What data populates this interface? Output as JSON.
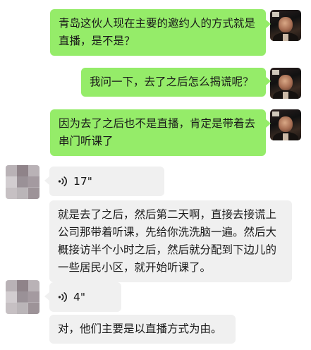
{
  "messages": [
    {
      "id": 1,
      "sender": "me",
      "type": "text",
      "text": "青岛这伙人现在主要的邀约人的方式就是直播，是不是？"
    },
    {
      "id": 2,
      "sender": "me",
      "type": "text",
      "text": "我问一下，去了之后怎么揭谎呢？"
    },
    {
      "id": 3,
      "sender": "me",
      "type": "text",
      "text": "因为去了之后也不是直播，肯定是带着去串门听课了"
    },
    {
      "id": 4,
      "sender": "other",
      "type": "voice",
      "duration": "17\""
    },
    {
      "id": 5,
      "sender": "other",
      "type": "text",
      "text": "就是去了之后，然后第二天啊，直接去接谎上公司那带着听课，先给你洗洗脑一遍。然后大概接访半个小时之后，然后就分配到下边儿的一些居民小区，就开始听课了。"
    },
    {
      "id": 6,
      "sender": "other",
      "type": "voice",
      "duration": "4\""
    },
    {
      "id": 7,
      "sender": "other",
      "type": "text",
      "text": "对，他们主要是以直播方式为由。"
    }
  ],
  "icons": {
    "voice": "voice-wave-icon"
  },
  "colors": {
    "my_bubble": "#95ec69",
    "other_bubble": "#f0f0f0",
    "background": "#ffffff"
  }
}
